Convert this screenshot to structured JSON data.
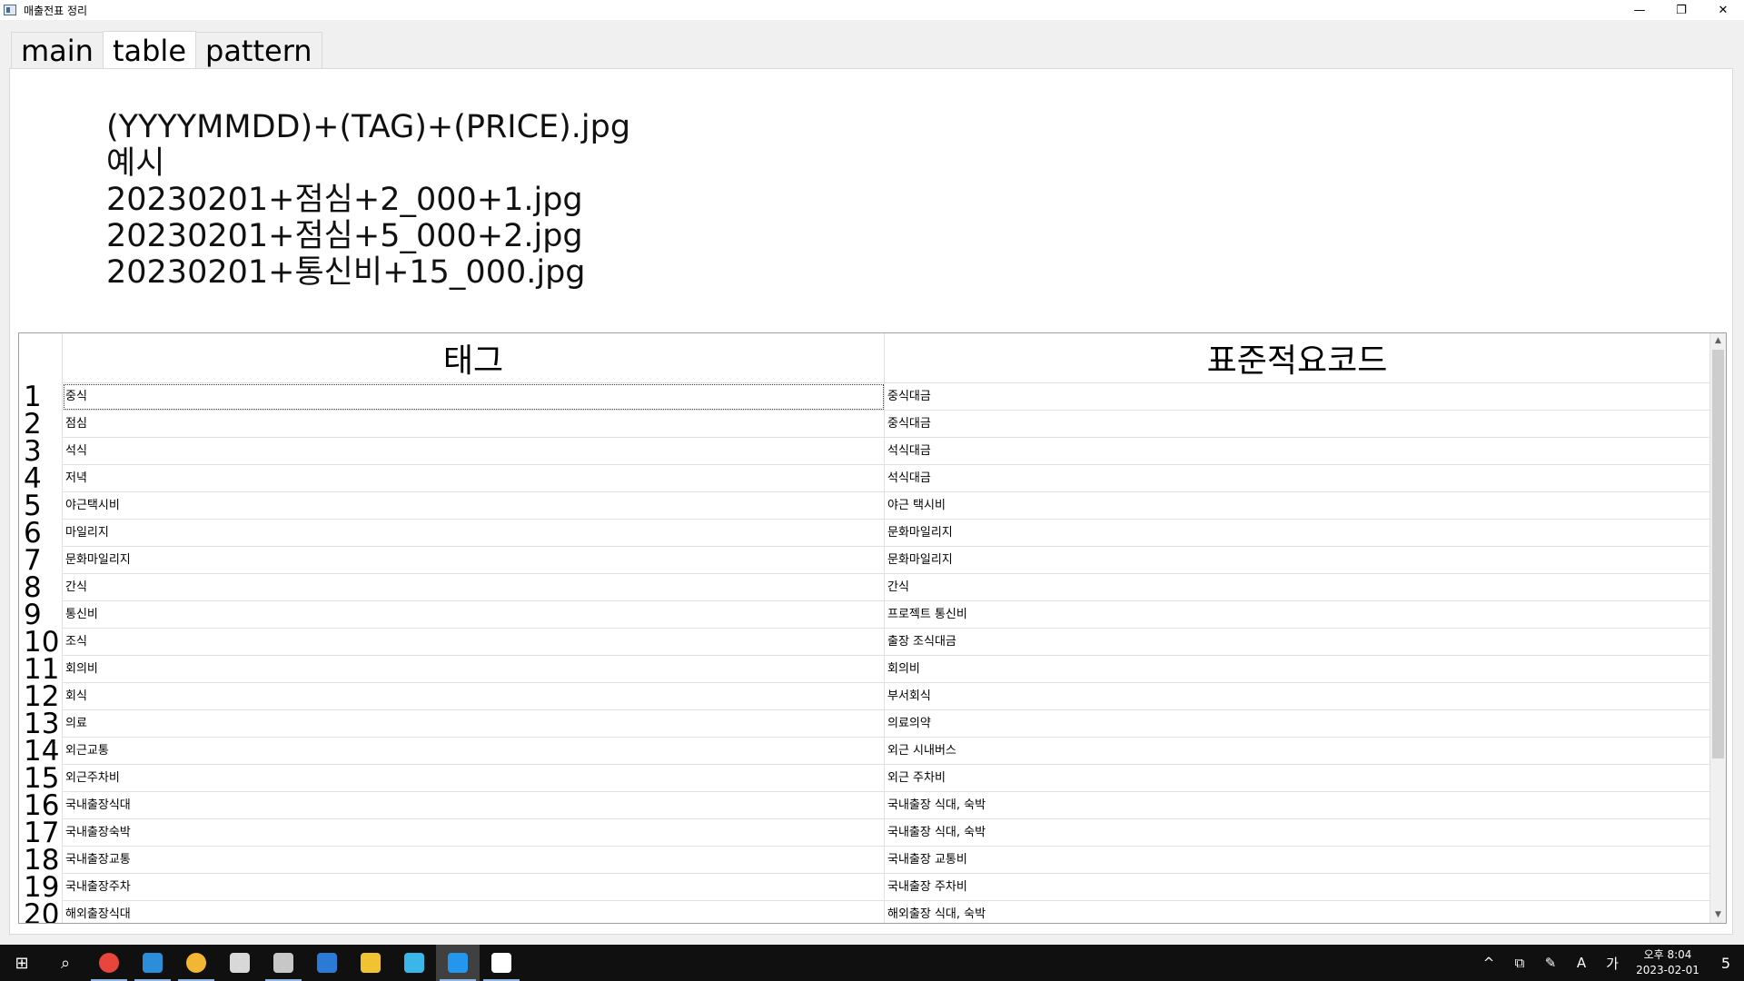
{
  "window": {
    "title": "매출전표 정리",
    "minimize": "—",
    "restore": "❐",
    "close": "✕"
  },
  "tabs": [
    {
      "label": "main",
      "active": false
    },
    {
      "label": "table",
      "active": true
    },
    {
      "label": "pattern",
      "active": false
    }
  ],
  "description": {
    "line1": "(YYYYMMDD)+(TAG)+(PRICE).jpg",
    "line2": "예시",
    "line3": "20230201+점심+2_000+1.jpg",
    "line4": "20230201+점심+5_000+2.jpg",
    "line5": "20230201+통신비+15_000.jpg"
  },
  "table": {
    "headers": {
      "tag": "태그",
      "code": "표준적요코드"
    },
    "rows": [
      {
        "num": "1",
        "tag": "중식",
        "code": "중식대금"
      },
      {
        "num": "2",
        "tag": "점심",
        "code": "중식대금"
      },
      {
        "num": "3",
        "tag": "석식",
        "code": "석식대금"
      },
      {
        "num": "4",
        "tag": "저녁",
        "code": "석식대금"
      },
      {
        "num": "5",
        "tag": "야근택시비",
        "code": "야근 택시비"
      },
      {
        "num": "6",
        "tag": "마일리지",
        "code": "문화마일리지"
      },
      {
        "num": "7",
        "tag": "문화마일리지",
        "code": "문화마일리지"
      },
      {
        "num": "8",
        "tag": "간식",
        "code": "간식"
      },
      {
        "num": "9",
        "tag": "통신비",
        "code": "프로젝트 통신비"
      },
      {
        "num": "10",
        "tag": "조식",
        "code": "출장 조식대금"
      },
      {
        "num": "11",
        "tag": "회의비",
        "code": "회의비"
      },
      {
        "num": "12",
        "tag": "회식",
        "code": "부서회식"
      },
      {
        "num": "13",
        "tag": "의료",
        "code": "의료의약"
      },
      {
        "num": "14",
        "tag": "외근교통",
        "code": "외근 시내버스"
      },
      {
        "num": "15",
        "tag": "외근주차비",
        "code": "외근 주차비"
      },
      {
        "num": "16",
        "tag": "국내출장식대",
        "code": "국내출장 식대, 숙박"
      },
      {
        "num": "17",
        "tag": "국내출장숙박",
        "code": "국내출장 식대, 숙박"
      },
      {
        "num": "18",
        "tag": "국내출장교통",
        "code": "국내출장 교통비"
      },
      {
        "num": "19",
        "tag": "국내출장주차",
        "code": "국내출장 주차비"
      },
      {
        "num": "20",
        "tag": "해외출장식대",
        "code": "해외출장 식대, 숙박"
      }
    ]
  },
  "scrollbar": {
    "up": "▲",
    "down": "▼"
  },
  "taskbar": {
    "start": "⊞",
    "search": "⌕",
    "apps": [
      {
        "name": "chrome-icon",
        "color": "#e8453c"
      },
      {
        "name": "vscode-icon",
        "color": "#2b8ed8"
      },
      {
        "name": "chrome-profile-icon",
        "color": "#f2b632"
      },
      {
        "name": "paint-icon",
        "color": "#d8d8d8"
      },
      {
        "name": "app-icon",
        "color": "#c7c7c7"
      },
      {
        "name": "calendar-icon",
        "color": "#2a7ad6"
      },
      {
        "name": "file-explorer-icon",
        "color": "#f1c232"
      },
      {
        "name": "bird-app-icon",
        "color": "#3ab6e8"
      },
      {
        "name": "docker-icon",
        "color": "#2496ed"
      },
      {
        "name": "sales-slip-app-icon",
        "color": "#ffffff"
      }
    ],
    "tray": {
      "chevron": "^",
      "meet": "⧉",
      "pen": "✎",
      "ime_mode": "A",
      "ime_lang": "가",
      "time": "오후 8:04",
      "date": "2023-02-01",
      "notifications": "5"
    }
  }
}
